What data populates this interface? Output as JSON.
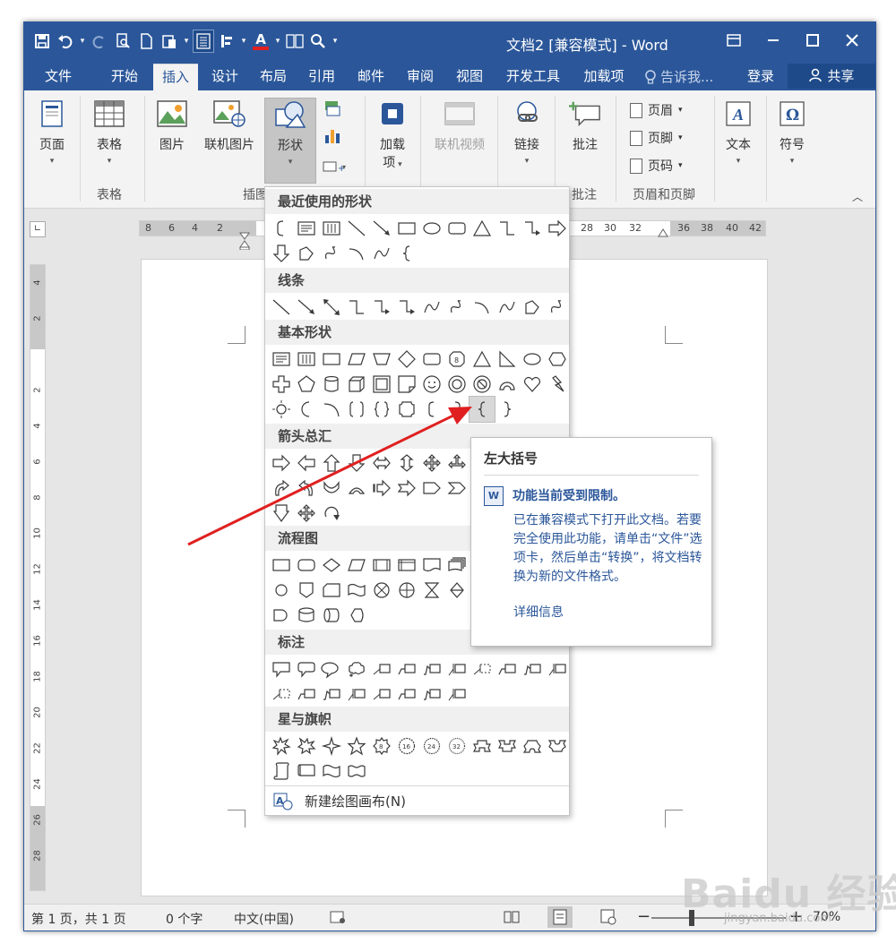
{
  "titlebar": {
    "doc_title": "文档2 [兼容模式] - Word",
    "qat": [
      "save-icon",
      "undo-icon",
      "redo-icon",
      "print-preview-icon",
      "new-doc-icon",
      "paste-icon",
      "format-icon",
      "paragraph-icon",
      "font-color-icon",
      "columns-icon",
      "find-icon",
      "customize-icon"
    ]
  },
  "tabs": {
    "file": "文件",
    "home": "开始",
    "insert": "插入",
    "design": "设计",
    "layout": "布局",
    "references": "引用",
    "mailings": "邮件",
    "review": "审阅",
    "view": "视图",
    "developer": "开发工具",
    "addins": "加载项",
    "tell": "告诉我...",
    "login": "登录",
    "share": "共享"
  },
  "ribbon": {
    "page": "页面",
    "table": "表格",
    "picture": "图片",
    "online_picture": "联机图片",
    "shapes": "形状",
    "addins": "加载",
    "addins2": "项",
    "online_video": "联机视频",
    "link": "链接",
    "comment": "批注",
    "header": "页眉",
    "footer": "页脚",
    "page_number": "页码",
    "text": "文本",
    "symbol": "符号",
    "groups": {
      "table": "表格",
      "illustrations": "插图",
      "comments": "批注",
      "header_footer": "页眉和页脚"
    }
  },
  "ruler": {
    "h_left": [
      "8",
      "6",
      "4",
      "2"
    ],
    "h_right": [
      "28",
      "30",
      "32",
      "36",
      "38",
      "40",
      "42"
    ],
    "v": [
      "4",
      "2",
      "2",
      "4",
      "6",
      "8",
      "10",
      "12",
      "14",
      "16",
      "18",
      "20",
      "22",
      "24",
      "26",
      "28"
    ]
  },
  "shapes_menu": {
    "sections": {
      "recent": "最近使用的形状",
      "lines": "线条",
      "basic": "基本形状",
      "arrows": "箭头总汇",
      "flowchart": "流程图",
      "callouts": "标注",
      "stars": "星与旗帜"
    },
    "new_canvas": "新建绘图画布(N)"
  },
  "tooltip": {
    "title": "左大括号",
    "head": "功能当前受到限制。",
    "body": "已在兼容模式下打开此文档。若要完全使用此功能，请单击“文件”选项卡，然后单击“转换”，将文档转换为新的文件格式。",
    "more": "详细信息"
  },
  "status": {
    "page": "第 1 页，共 1 页",
    "words": "0 个字",
    "lang": "中文(中国)",
    "zoom": "70%"
  },
  "watermark": {
    "main": "Baidu 经验",
    "sub": "jingyan.baidu.com"
  },
  "colors": {
    "accent": "#2b579a",
    "arrow": "#e02020"
  }
}
